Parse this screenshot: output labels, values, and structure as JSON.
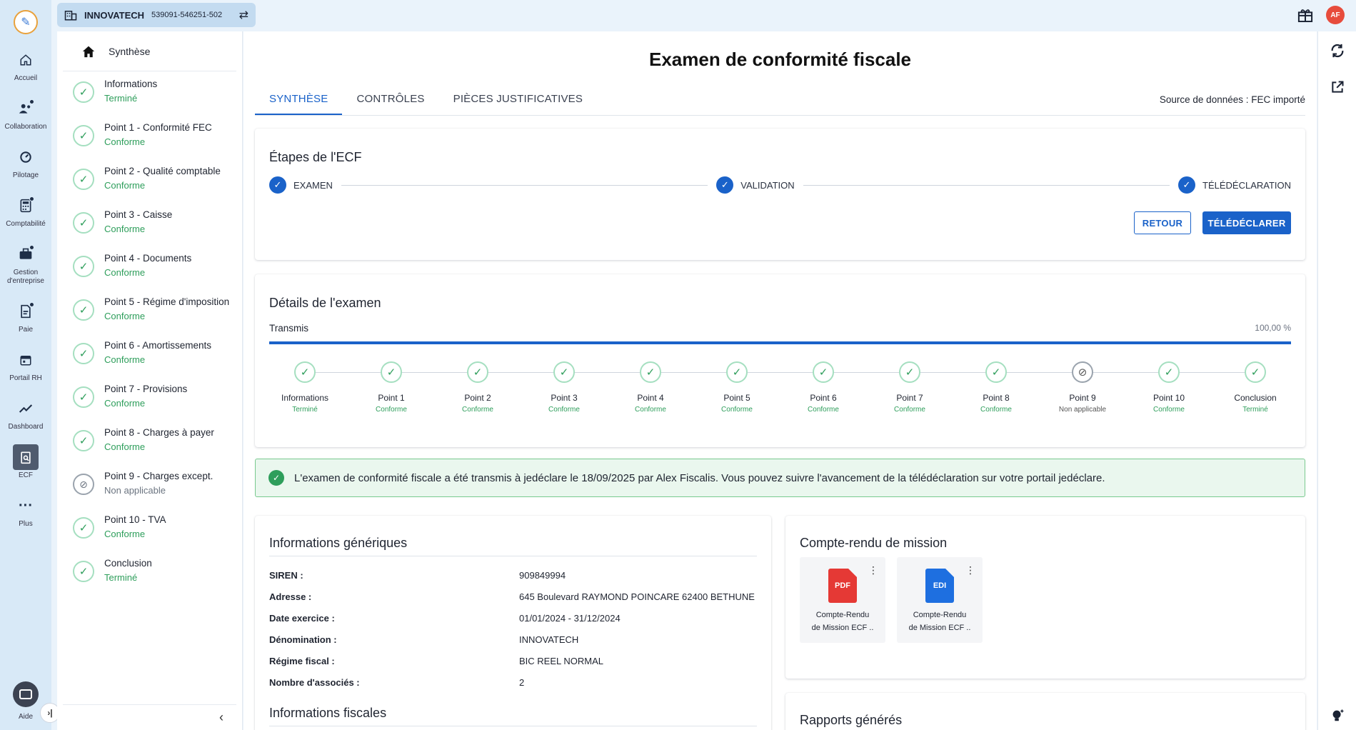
{
  "company": {
    "name": "INNOVATECH",
    "ids": "539091-546251-502"
  },
  "user": {
    "initials": "AF"
  },
  "colors": {
    "accent": "#1a62c9",
    "success": "#2e9e5b",
    "danger": "#e53935"
  },
  "nav": [
    {
      "label": "Accueil",
      "icon": "home-icon"
    },
    {
      "label": "Collaboration",
      "icon": "people-icon"
    },
    {
      "label": "Pilotage",
      "icon": "gauge-icon"
    },
    {
      "label": "Comptabilité",
      "icon": "calculator-icon"
    },
    {
      "label": "Gestion d'entreprise",
      "icon": "briefcase-icon"
    },
    {
      "label": "Paie",
      "icon": "payslip-icon"
    },
    {
      "label": "Portail RH",
      "icon": "calendar-icon"
    },
    {
      "label": "Dashboard",
      "icon": "trend-icon"
    },
    {
      "label": "ECF",
      "icon": "ecf-icon"
    },
    {
      "label": "Plus",
      "icon": "more-icon"
    }
  ],
  "help_label": "Aide",
  "sidepanel": {
    "synthese": "Synthèse",
    "steps": [
      {
        "title": "Informations",
        "status": "Terminé"
      },
      {
        "title": "Point 1 - Conformité FEC",
        "status": "Conforme"
      },
      {
        "title": "Point 2 - Qualité comptable",
        "status": "Conforme"
      },
      {
        "title": "Point 3 - Caisse",
        "status": "Conforme"
      },
      {
        "title": "Point 4 - Documents",
        "status": "Conforme"
      },
      {
        "title": "Point 5 - Régime d'imposition",
        "status": "Conforme"
      },
      {
        "title": "Point 6 - Amortissements",
        "status": "Conforme"
      },
      {
        "title": "Point 7 - Provisions",
        "status": "Conforme"
      },
      {
        "title": "Point 8 - Charges à payer",
        "status": "Conforme"
      },
      {
        "title": "Point 9 - Charges except.",
        "status": "Non applicable"
      },
      {
        "title": "Point 10 - TVA",
        "status": "Conforme"
      },
      {
        "title": "Conclusion",
        "status": "Terminé"
      }
    ]
  },
  "main": {
    "title": "Examen de conformité fiscale",
    "tabs": [
      "SYNTHÈSE",
      "CONTRÔLES",
      "PIÈCES JUSTIFICATIVES"
    ],
    "data_source": "Source de données : FEC importé",
    "etapes": {
      "title": "Étapes de l'ECF",
      "steps": [
        "EXAMEN",
        "VALIDATION",
        "TÉLÉDÉCLARATION"
      ],
      "btn_back": "RETOUR",
      "btn_submit": "TÉLÉDÉCLARER"
    },
    "details": {
      "title": "Détails de l'examen",
      "progress_label": "Transmis",
      "progress_value": "100,00 %",
      "progress_fraction": 1.0,
      "points": [
        {
          "name": "Informations",
          "status": "Terminé"
        },
        {
          "name": "Point 1",
          "status": "Conforme"
        },
        {
          "name": "Point 2",
          "status": "Conforme"
        },
        {
          "name": "Point 3",
          "status": "Conforme"
        },
        {
          "name": "Point 4",
          "status": "Conforme"
        },
        {
          "name": "Point 5",
          "status": "Conforme"
        },
        {
          "name": "Point 6",
          "status": "Conforme"
        },
        {
          "name": "Point 7",
          "status": "Conforme"
        },
        {
          "name": "Point 8",
          "status": "Conforme"
        },
        {
          "name": "Point 9",
          "status": "Non applicable"
        },
        {
          "name": "Point 10",
          "status": "Conforme"
        },
        {
          "name": "Conclusion",
          "status": "Terminé"
        }
      ]
    },
    "alert": "L'examen de conformité fiscale a été transmis à jedéclare le 18/09/2025 par Alex Fiscalis. Vous pouvez suivre l'avancement de la télédéclaration sur votre portail jedéclare.",
    "generic": {
      "title": "Informations génériques",
      "rows": [
        {
          "k": "SIREN :",
          "v": "909849994"
        },
        {
          "k": "Adresse :",
          "v": "645 Boulevard RAYMOND POINCARE 62400 BETHUNE"
        },
        {
          "k": "Date exercice :",
          "v": "01/01/2024 - 31/12/2024"
        },
        {
          "k": "Dénomination :",
          "v": "INNOVATECH"
        },
        {
          "k": "Régime fiscal :",
          "v": "BIC REEL NORMAL"
        },
        {
          "k": "Nombre d'associés :",
          "v": "2"
        }
      ],
      "fiscal_title": "Informations fiscales"
    },
    "compte_rendu": {
      "title": "Compte-rendu de mission",
      "docs": [
        {
          "type": "PDF",
          "label1": "Compte-Rendu",
          "label2": "de Mission ECF ..",
          "color": "#e53935"
        },
        {
          "type": "EDI",
          "label1": "Compte-Rendu",
          "label2": "de Mission ECF ..",
          "color": "#1e6fe0"
        }
      ]
    },
    "rapports_title": "Rapports générés"
  }
}
